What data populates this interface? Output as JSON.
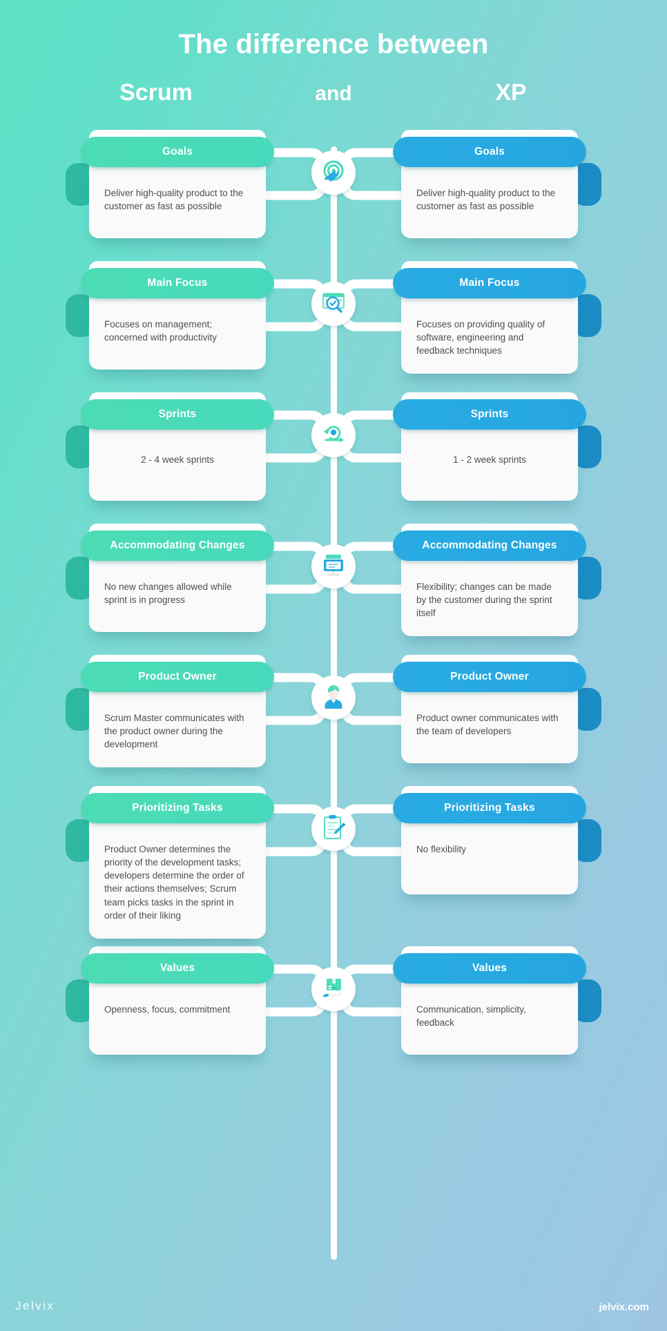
{
  "header": {
    "title": "The difference between",
    "left_label": "Scrum",
    "conjunction": "and",
    "right_label": "XP"
  },
  "colors": {
    "scrum_accent": "#4EDCB9",
    "xp_accent": "#29ABE2",
    "scrum_stub": "#2FB9A0",
    "xp_stub": "#1C8CC4",
    "card_body": "#FAFAFA",
    "body_text": "#4A5055",
    "bg_from": "#5DE2C6",
    "bg_to": "#9EC6E4"
  },
  "footer": {
    "brand": "Jelvix",
    "website": "jelvix.com"
  },
  "rows": [
    {
      "icon": "target-arrow-icon",
      "align": "left",
      "scrum": {
        "title": "Goals",
        "text": "Deliver high-quality product to the customer as fast as possible"
      },
      "xp": {
        "title": "Goals",
        "text": "Deliver high-quality product to the customer as fast as possible"
      }
    },
    {
      "icon": "magnifier-window-icon",
      "align": "left",
      "scrum": {
        "title": "Main Focus",
        "text": "Focuses on management; concerned with productivity"
      },
      "xp": {
        "title": "Main Focus",
        "text": "Focuses on providing quality of software, engineering and feedback techniques"
      }
    },
    {
      "icon": "sprint-cycle-icon",
      "align": "center",
      "scrum": {
        "title": "Sprints",
        "text": "2 - 4 week sprints"
      },
      "xp": {
        "title": "Sprints",
        "text": "1 - 2 week sprints"
      }
    },
    {
      "icon": "monitor-icon",
      "align": "left",
      "scrum": {
        "title": "Accommodating Changes",
        "text": "No new changes allowed while sprint is in progress"
      },
      "xp": {
        "title": "Accommodating Changes",
        "text": "Flexibility; changes can be made by the customer during the sprint itself"
      }
    },
    {
      "icon": "person-icon",
      "align": "left",
      "scrum": {
        "title": "Product Owner",
        "text": "Scrum Master communicates with the product owner during the development"
      },
      "xp": {
        "title": "Product Owner",
        "text": "Product owner communicates with the team of developers"
      }
    },
    {
      "icon": "clipboard-pencil-icon",
      "align": "left",
      "scrum": {
        "title": "Prioritizing Tasks",
        "text": "Product Owner determines the priority of the development tasks;  developers determine the order of their actions themselves; Scrum team picks tasks in the sprint in order of their liking"
      },
      "xp": {
        "title": "Prioritizing Tasks",
        "text": "No flexibility"
      }
    },
    {
      "icon": "box-hand-icon",
      "align": "left",
      "scrum": {
        "title": "Values",
        "text": "Openness, focus, commitment"
      },
      "xp": {
        "title": "Values",
        "text": "Communication, simplicity, feedback"
      }
    }
  ]
}
